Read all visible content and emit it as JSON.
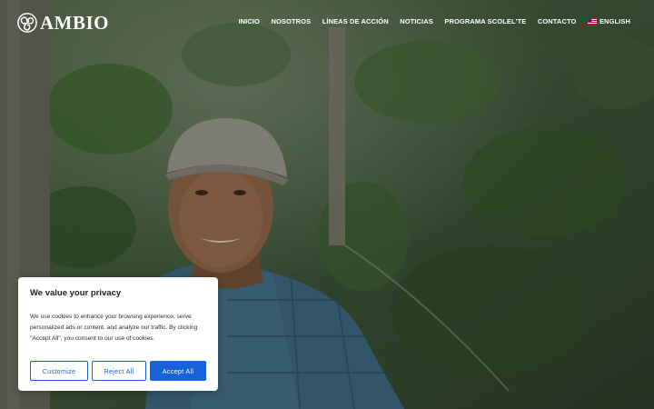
{
  "brand": {
    "name": "AMBIO",
    "logo_icon": "triskele-icon"
  },
  "nav": {
    "items": [
      {
        "label": "INICIO"
      },
      {
        "label": "NOSOTROS"
      },
      {
        "label": "LÍNEAS DE ACCIÓN"
      },
      {
        "label": "NOTICIAS"
      },
      {
        "label": "PROGRAMA SCOLEL'TE"
      },
      {
        "label": "CONTACTO"
      }
    ],
    "language": {
      "label": "ENGLISH",
      "flag_icon": "us-flag-icon"
    }
  },
  "cookie_banner": {
    "title": "We value your privacy",
    "text": "We use cookies to enhance your browsing experience, serve personalized ads or content, and analyze our traffic. By clicking \"Accept All\", you consent to our use of cookies.",
    "buttons": {
      "customize": "Customize",
      "reject": "Reject All",
      "accept": "Accept All"
    },
    "accent_color": "#1863dc"
  }
}
